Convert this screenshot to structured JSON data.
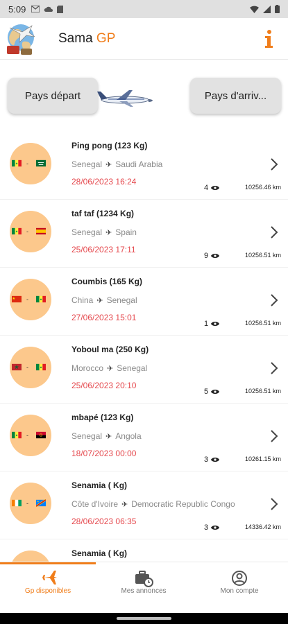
{
  "status_bar": {
    "time": "5:09"
  },
  "app": {
    "title_main": "Sama ",
    "title_accent": "GP",
    "accent_color": "#f07d1a",
    "info_icon": "info-icon"
  },
  "filters": {
    "departure_label": "Pays départ",
    "arrival_label": "Pays d'arriv...",
    "plane_icon": "airplane-icon"
  },
  "listings": [
    {
      "title": "Ping pong  (123 Kg)",
      "from": "Senegal",
      "to": "Saudi Arabia",
      "date": "28/06/2023 16:24",
      "views": "4",
      "distance": "10256.46 km",
      "flag_from": "senegal",
      "flag_to": "saudi-arabia"
    },
    {
      "title": "taf taf  (1234 Kg)",
      "from": "Senegal",
      "to": "Spain",
      "date": "25/06/2023 17:11",
      "views": "9",
      "distance": "10256.51 km",
      "flag_from": "senegal",
      "flag_to": "spain"
    },
    {
      "title": "Coumbis  (165 Kg)",
      "from": "China",
      "to": "Senegal",
      "date": "27/06/2023 15:01",
      "views": "1",
      "distance": "10256.51 km",
      "flag_from": "china",
      "flag_to": "senegal"
    },
    {
      "title": "Yoboul ma  (250 Kg)",
      "from": "Morocco",
      "to": "Senegal",
      "date": "25/06/2023 20:10",
      "views": "5",
      "distance": "10256.51 km",
      "flag_from": "morocco",
      "flag_to": "senegal"
    },
    {
      "title": "mbapé (123 Kg)",
      "from": "Senegal",
      "to": "Angola",
      "date": "18/07/2023 00:00",
      "views": "3",
      "distance": "10261.15 km",
      "flag_from": "senegal",
      "flag_to": "angola"
    },
    {
      "title": "Senamia ( Kg)",
      "from": "Côte d'Ivoire",
      "to": "Democratic Republic Congo",
      "date": "28/06/2023 06:35",
      "views": "3",
      "distance": "14336.42 km",
      "flag_from": "cote-divoire",
      "flag_to": "dr-congo"
    },
    {
      "title": "Senamia ( Kg)",
      "from": "",
      "to": "",
      "date": "",
      "views": "",
      "distance": "",
      "flag_from": "",
      "flag_to": ""
    }
  ],
  "bottom_nav": {
    "tabs": [
      {
        "label": "Gp disponibles",
        "icon": "airplane-icon",
        "active": true
      },
      {
        "label": "Mes annonces",
        "icon": "suitcase-clock-icon",
        "active": false
      },
      {
        "label": "Mon compte",
        "icon": "account-icon",
        "active": false
      }
    ]
  }
}
